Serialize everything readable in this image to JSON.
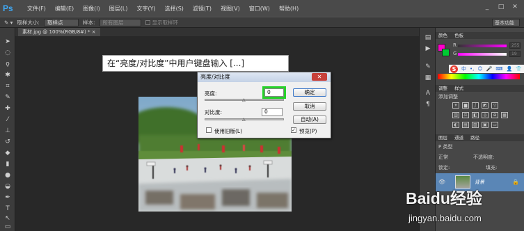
{
  "app": {
    "logo": "Ps",
    "menu": [
      "文件(F)",
      "编辑(E)",
      "图像(I)",
      "图层(L)",
      "文字(Y)",
      "选择(S)",
      "滤镜(T)",
      "视图(V)",
      "窗口(W)",
      "帮助(H)"
    ],
    "window_controls": [
      "_",
      "□",
      "✕"
    ]
  },
  "options_bar": {
    "sample_size_label": "取样大小:",
    "sample_size_value": "取样点",
    "sample_label": "样本:",
    "sample_value": "所有图层",
    "show_ring_label": "显示取样环",
    "workspace": "基本功能"
  },
  "document": {
    "tab_title": "素材.jpg @ 100%(RGB/8#) * ×"
  },
  "annotation": {
    "text": "在“亮度/对比度”中用户键盘输入 [...]"
  },
  "dialog": {
    "title": "亮度/对比度",
    "close": "✕",
    "brightness_label": "亮度:",
    "brightness_value": "0",
    "contrast_label": "对比度:",
    "contrast_value": "0",
    "slider_thumb": "△",
    "ok": "确定",
    "cancel": "取消",
    "auto": "自动(A)",
    "legacy_label": "使用旧版(L)",
    "preview_label": "预览(P)",
    "preview_checked": "✓"
  },
  "panels": {
    "color_tabs": [
      "颜色",
      "色板"
    ],
    "r_label": "R",
    "g_label": "G",
    "r_value": "255",
    "g_value": "19",
    "foreground_color": "#ff00cc",
    "background_color": "#00cc33",
    "ime_items": [
      "S",
      "中",
      "•,",
      "☺",
      "🎤",
      "⌨",
      "👤",
      "👕"
    ],
    "adjust_tabs": [
      "调整",
      "样式"
    ],
    "adjust_title": "添加调整",
    "layers_tabs": [
      "图层",
      "通道",
      "路径"
    ],
    "layer_kind": "P 类型",
    "blend_mode": "正常",
    "opacity_label": "不透明度:",
    "lock_label": "锁定:",
    "fill_label": "填充:",
    "layer_name": "背景",
    "layer_eye": "👁",
    "layer_lock": "🔒"
  },
  "watermark": {
    "brand": "Baidu经验",
    "url": "jingyan.baidu.com"
  }
}
